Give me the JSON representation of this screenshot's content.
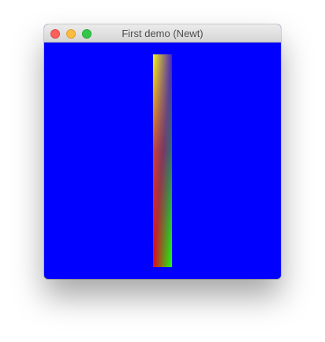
{
  "window": {
    "title": "First demo (Newt)",
    "controls": {
      "close": "close-window",
      "minimize": "minimize-window",
      "zoom": "zoom-window"
    }
  },
  "canvas": {
    "background_color": "#0000ff",
    "quad_corner_colors": {
      "top_left": "#ffff00",
      "top_right": "#0000ff",
      "bottom_left": "#ff0000",
      "bottom_right": "#00ff00"
    }
  }
}
